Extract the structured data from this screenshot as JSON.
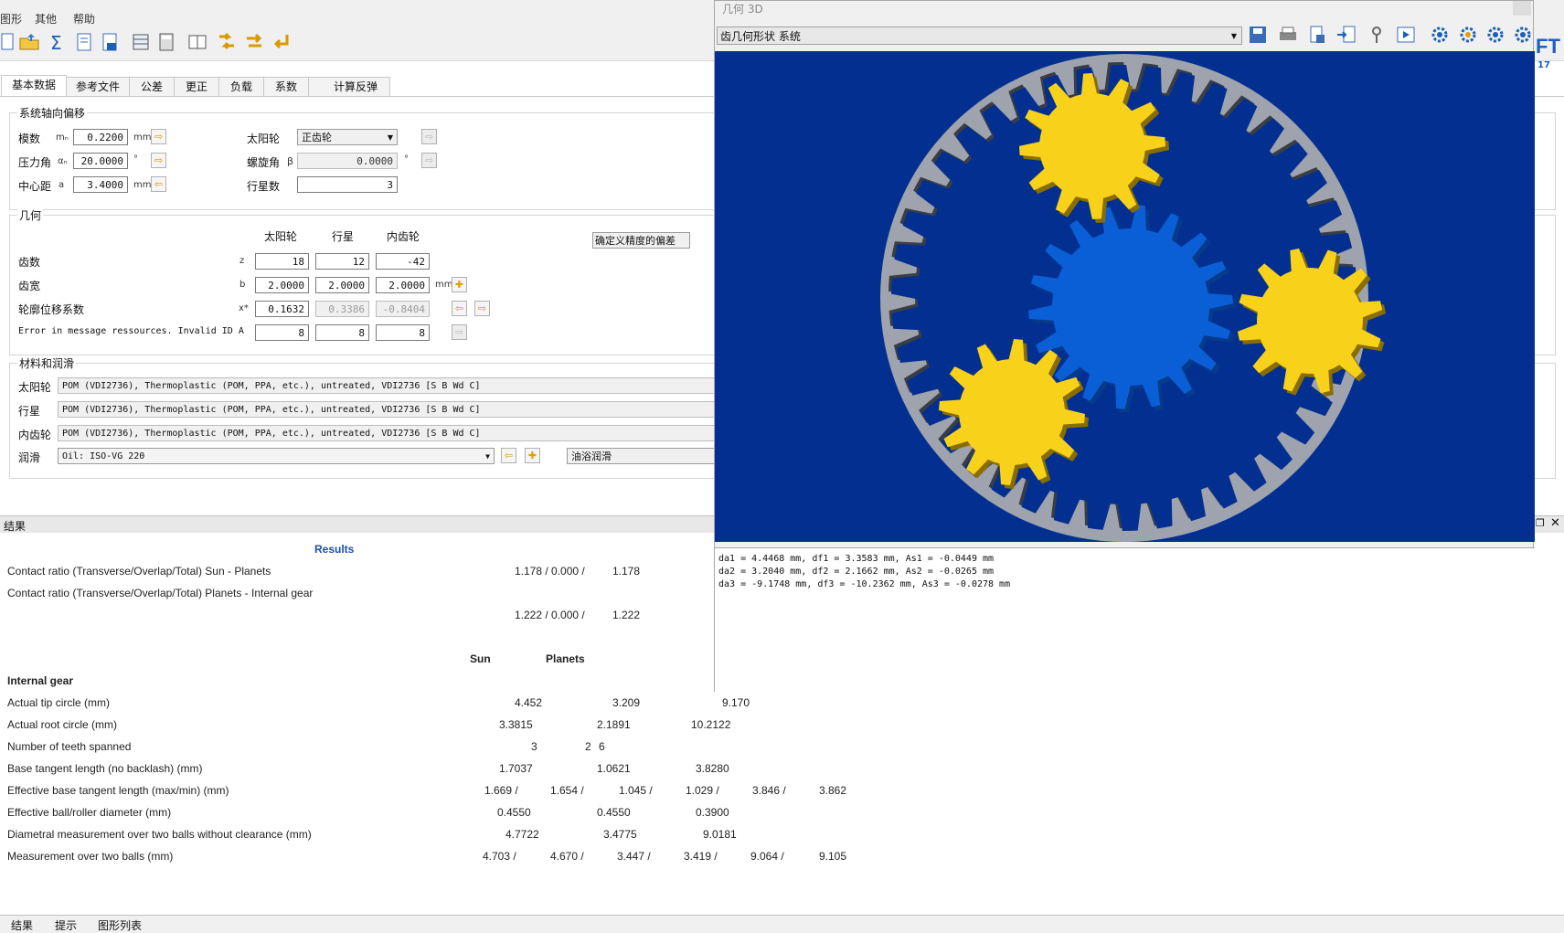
{
  "menu": {
    "items": [
      "图形",
      "其他",
      "帮助"
    ]
  },
  "tabs": [
    "基本数据",
    "参考文件",
    "公差",
    "更正",
    "负载",
    "系数",
    "计算反弹"
  ],
  "system": {
    "group_title": "系统轴向偏移",
    "module": {
      "label": "模数",
      "symbol": "mₙ",
      "value": "0.2200",
      "unit": "mm"
    },
    "pressure_angle": {
      "label": "压力角",
      "symbol": "αₙ",
      "value": "20.0000",
      "unit": "°"
    },
    "center_distance": {
      "label": "中心距",
      "symbol": "a",
      "value": "3.4000",
      "unit": "mm"
    },
    "sun_type": {
      "label": "太阳轮",
      "value": "正齿轮"
    },
    "helix_angle": {
      "label": "螺旋角",
      "symbol": "β",
      "value": "0.0000",
      "unit": "°"
    },
    "planet_count": {
      "label": "行星数",
      "value": "3"
    }
  },
  "geometry": {
    "group_title": "几何",
    "columns": [
      "太阳轮",
      "行星",
      "内齿轮"
    ],
    "tolerance_button": "确定义精度的偏差",
    "rows": [
      {
        "label": "齿数",
        "symbol": "z",
        "values": [
          "18",
          "12",
          "-42"
        ],
        "unit": ""
      },
      {
        "label": "齿宽",
        "symbol": "b",
        "values": [
          "2.0000",
          "2.0000",
          "2.0000"
        ],
        "unit": "mm"
      },
      {
        "label": "轮廓位移系数",
        "symbol": "x*",
        "values": [
          "0.1632",
          "0.3386",
          "-0.8404"
        ],
        "unit": ""
      },
      {
        "label": "Error in message ressources. Invalid ID A",
        "symbol": "",
        "values": [
          "8",
          "8",
          "8"
        ],
        "unit": ""
      }
    ]
  },
  "materials": {
    "group_title": "材料和润滑",
    "rows": [
      {
        "label": "太阳轮",
        "value": "POM (VDI2736), Thermoplastic (POM, PPA, etc.), untreated, VDI2736 [S B Wd C]"
      },
      {
        "label": "行星",
        "value": "POM (VDI2736), Thermoplastic (POM, PPA, etc.), untreated, VDI2736 [S B Wd C]"
      },
      {
        "label": "内齿轮",
        "value": "POM (VDI2736), Thermoplastic (POM, PPA, etc.), untreated, VDI2736 [S B Wd C]"
      }
    ],
    "lubrication": {
      "label": "润滑",
      "value": "Oil: ISO-VG 220",
      "type": "油浴润滑"
    }
  },
  "results_bar": {
    "title": "结果"
  },
  "results": {
    "heading": "Results",
    "contact1_label": "Contact ratio (Transverse/Overlap/Total) Sun - Planets",
    "contact1_values": [
      "1.178 / 0.000 /",
      "1.178"
    ],
    "contact2_label": "Contact ratio (Transverse/Overlap/Total) Planets - Internal gear",
    "contact2_values": [
      "1.222 / 0.000 /",
      "1.222"
    ],
    "col_sun": "Sun",
    "col_planets": "Planets",
    "section": "Internal gear",
    "rows": [
      {
        "label": "Actual tip circle (mm)",
        "v": [
          "4.452",
          "3.209",
          "9.170"
        ]
      },
      {
        "label": "Actual root circle (mm)",
        "v": [
          "3.3815",
          "2.1891",
          "10.2122"
        ]
      },
      {
        "label": "Number of teeth spanned",
        "v": [
          "3",
          "2",
          "6"
        ]
      },
      {
        "label": "Base tangent length (no backlash) (mm)",
        "v": [
          "1.7037",
          "1.0621",
          "3.8280"
        ]
      },
      {
        "label": "Effective base tangent length (max/min) (mm)",
        "v": [
          "1.669 /",
          "1.654 /",
          "1.045 /",
          "1.029 /",
          "3.846 /",
          "3.862"
        ]
      },
      {
        "label": "Effective ball/roller diameter (mm)",
        "v": [
          "0.4550",
          "0.4550",
          "0.3900"
        ]
      },
      {
        "label": "Diametral measurement over two balls without clearance (mm)",
        "v": [
          "4.7722",
          "3.4775",
          "9.0181"
        ]
      },
      {
        "label": "Measurement over two balls (mm)",
        "v": [
          "4.703 /",
          "4.670 /",
          "3.447 /",
          "3.419 /",
          "9.064 /",
          "9.105"
        ]
      }
    ]
  },
  "bottom_tabs": [
    "结果",
    "提示",
    "图形列表"
  ],
  "geometry_window": {
    "title": "几何 3D",
    "combo": "齿几何形状 系统",
    "text_lines": [
      "da1 = 4.4468 mm, df1 = 3.3583 mm, As1 = -0.0449 mm",
      "da2 = 3.2040 mm, df2 = 2.1662 mm, As2 = -0.0265 mm",
      "da3 = -9.1748 mm, df3 = -10.2362 mm, As3 = -0.0278 mm"
    ],
    "colors": {
      "background": "#033090",
      "ring": "#9ea3ad",
      "sun": "#0a5fd6",
      "planet": "#f8d21a"
    },
    "sun_teeth": 18,
    "planet_teeth": 12,
    "ring_teeth": 42
  },
  "brand": {
    "fragment": "FT",
    "year": "17"
  }
}
